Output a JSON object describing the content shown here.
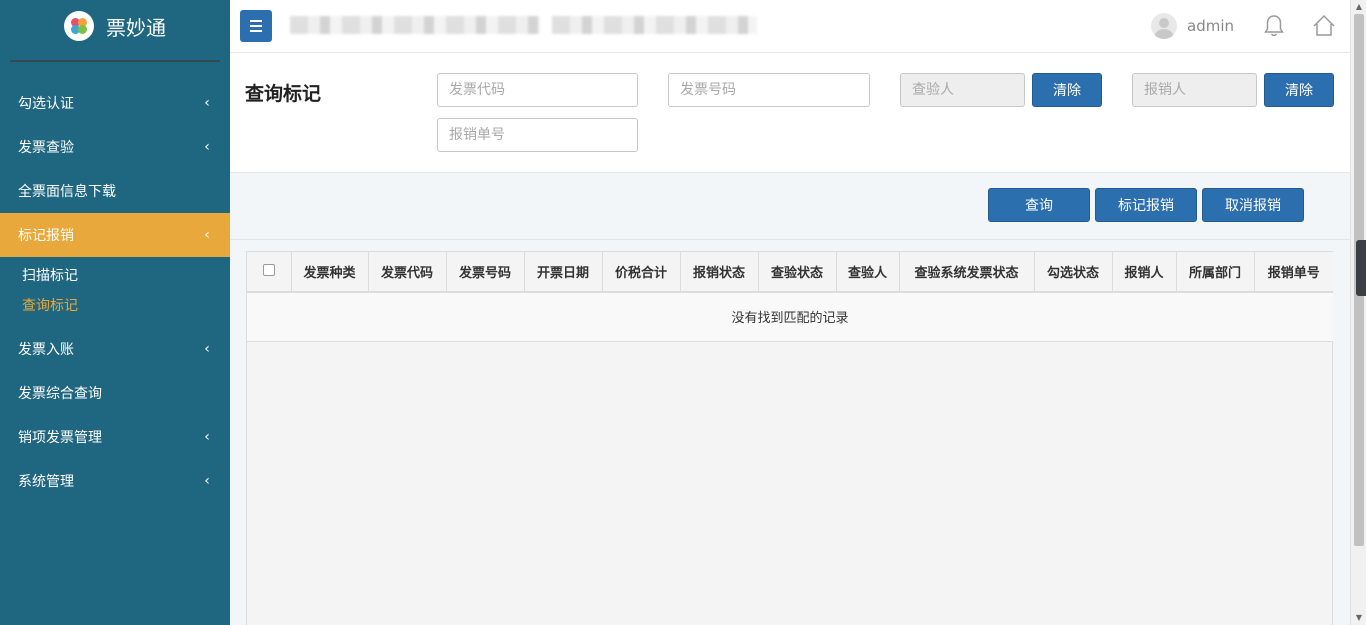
{
  "brand": {
    "name": "票妙通"
  },
  "sidebar": {
    "items": [
      {
        "label": "勾选认证",
        "chevron": "‹"
      },
      {
        "label": "发票查验",
        "chevron": "‹"
      },
      {
        "label": "全票面信息下载",
        "chevron": ""
      },
      {
        "label": "标记报销",
        "chevron": "‹",
        "active": true
      },
      {
        "label": "发票入账",
        "chevron": "‹"
      },
      {
        "label": "发票综合查询",
        "chevron": ""
      },
      {
        "label": "销项发票管理",
        "chevron": "‹"
      },
      {
        "label": "系统管理",
        "chevron": "‹"
      }
    ],
    "sub_items": [
      {
        "label": "扫描标记"
      },
      {
        "label": "查询标记",
        "current": true
      }
    ]
  },
  "header": {
    "user": "admin",
    "icons": [
      "menu-icon",
      "user-avatar-icon",
      "bell-icon",
      "home-icon"
    ]
  },
  "filter": {
    "title": "查询标记",
    "invoice_code_placeholder": "发票代码",
    "invoice_number_placeholder": "发票号码",
    "inspector_placeholder": "查验人",
    "clear1": "清除",
    "reimburser_placeholder": "报销人",
    "clear2": "清除",
    "reimburse_no_placeholder": "报销单号"
  },
  "actions": {
    "query": "查询",
    "mark": "标记报销",
    "cancel": "取消报销"
  },
  "table": {
    "columns": [
      "发票种类",
      "发票代码",
      "发票号码",
      "开票日期",
      "价税合计",
      "报销状态",
      "查验状态",
      "查验人",
      "查验系统发票状态",
      "勾选状态",
      "报销人",
      "所属部门",
      "报销单号"
    ],
    "empty_message": "没有找到匹配的记录"
  },
  "colors": {
    "sidebar_bg": "#1f6680",
    "accent": "#e9a83b",
    "primary_button": "#2c6fae"
  }
}
